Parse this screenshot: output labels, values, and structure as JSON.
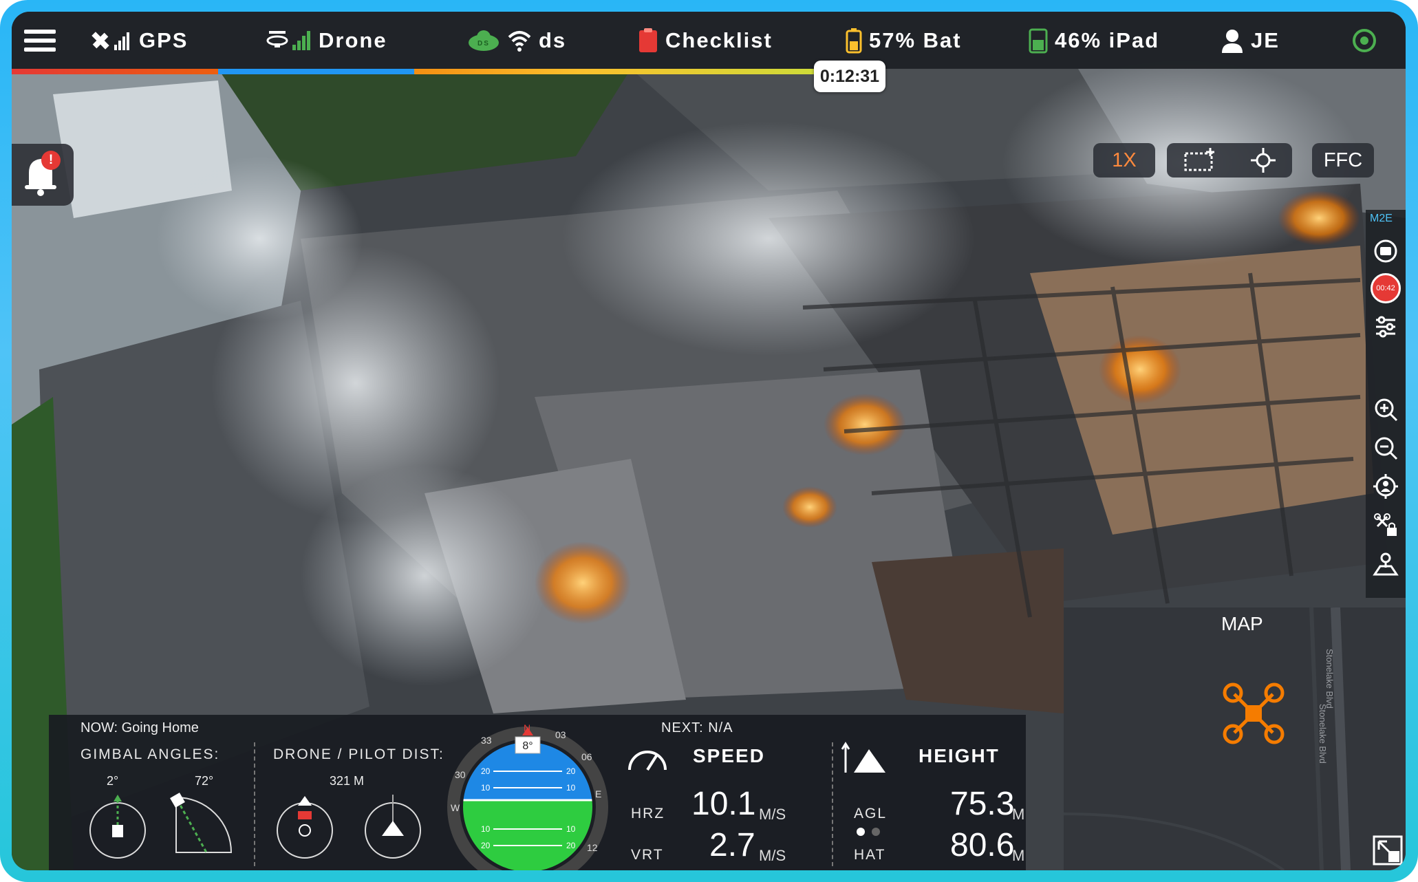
{
  "topbar": {
    "gps_label": "GPS",
    "drone_label": "Drone",
    "ds_badge": "DS",
    "wifi_label": "ds",
    "checklist_label": "Checklist",
    "battery_label": "57% Bat",
    "ipad_label": "46% iPad",
    "user_label": "JE",
    "flight_timer": "0:12:31"
  },
  "notifications": {
    "badge": "!"
  },
  "camera": {
    "zoom_label": "1X",
    "ffc_label": "FFC"
  },
  "right_toolbar": {
    "model_label": "M2E",
    "record_time": "00:42"
  },
  "telemetry": {
    "now_text": "NOW:  Going Home",
    "next_text": "NEXT: N/A",
    "gimbal_title": "GIMBAL ANGLES:",
    "gimbal_pitch": "2°",
    "gimbal_yaw": "72°",
    "dist_title": "DRONE / PILOT DIST:",
    "dist_value": "321 M",
    "heading": "8°",
    "compass_marks": [
      "N",
      "03",
      "06",
      "E",
      "12",
      "W",
      "30",
      "33"
    ],
    "pitch_marks": [
      "20",
      "10",
      "10",
      "20"
    ],
    "speed_title": "SPEED",
    "hrz_label": "HRZ",
    "hrz_value": "10.1",
    "hrz_unit": "M/S",
    "vrt_label": "VRT",
    "vrt_value": "2.7",
    "vrt_unit": "M/S",
    "height_title": "HEIGHT",
    "agl_label": "AGL",
    "agl_value": "75.3",
    "agl_unit": "M",
    "hat_label": "HAT",
    "hat_value": "80.6",
    "hat_unit": "M"
  },
  "map": {
    "title": "MAP",
    "street_1": "Stonelake Blvd",
    "street_2": "Stonelake Blvd"
  },
  "colors": {
    "bar_bg": "#1e2126",
    "accent_green": "#4caf50",
    "alert_red": "#e53935",
    "drone_orange": "#f57c00",
    "sky_blue": "#1e88e5",
    "ground_green": "#2ecc40"
  }
}
